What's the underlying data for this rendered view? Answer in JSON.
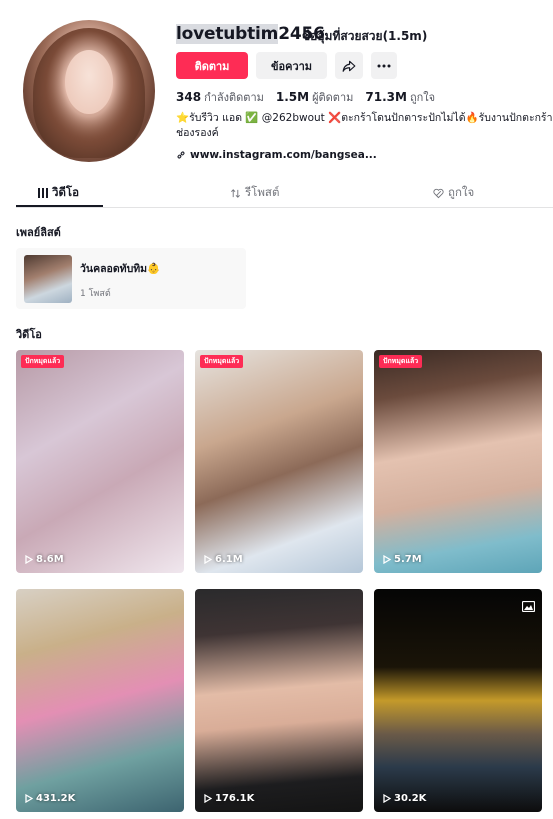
{
  "profile": {
    "username_highlight": "lovetubtim",
    "username_rest": "2456",
    "nickname": "ชื่ออุ้มที่สวยสวย(1.5m)",
    "follow_label": "ติดตาม",
    "message_label": "ข้อความ",
    "stats": [
      {
        "value": "348",
        "label": "กำลังติดตาม"
      },
      {
        "value": "1.5M",
        "label": "ผู้ติดตาม"
      },
      {
        "value": "71.3M",
        "label": "ถูกใจ"
      }
    ],
    "bio": "⭐รับรีวิว แอด ✅ @262bwout ❌ตะกร้าโดนปักตาระปักไม่ได้🔥รับงานปักตะกร้าช่องรองค์",
    "link": "www.instagram.com/bangsea..."
  },
  "tabs": [
    {
      "label": "วิดีโอ",
      "icon": "grid-icon"
    },
    {
      "label": "รีโพสต์",
      "icon": "repost-icon"
    },
    {
      "label": "ถูกใจ",
      "icon": "heart-icon"
    }
  ],
  "playlists_section": {
    "title": "เพลย์ลิสต์",
    "items": [
      {
        "name": "วันคลอดทับทิม👶",
        "count": "1 โพสต์"
      }
    ]
  },
  "videos_section": {
    "title": "วิดีโอ",
    "items": [
      {
        "views": "8.6M",
        "badge": "ปักหมุดแล้ว"
      },
      {
        "views": "6.1M",
        "badge": "ปักหมุดแล้ว"
      },
      {
        "views": "5.7M",
        "badge": "ปักหมุดแล้ว"
      },
      {
        "views": "431.2K",
        "badge": ""
      },
      {
        "views": "176.1K",
        "badge": ""
      },
      {
        "views": "30.2K",
        "badge": ""
      }
    ]
  },
  "colors": {
    "accent": "#fe2c55",
    "text": "#161823",
    "muted": "#73757c"
  }
}
